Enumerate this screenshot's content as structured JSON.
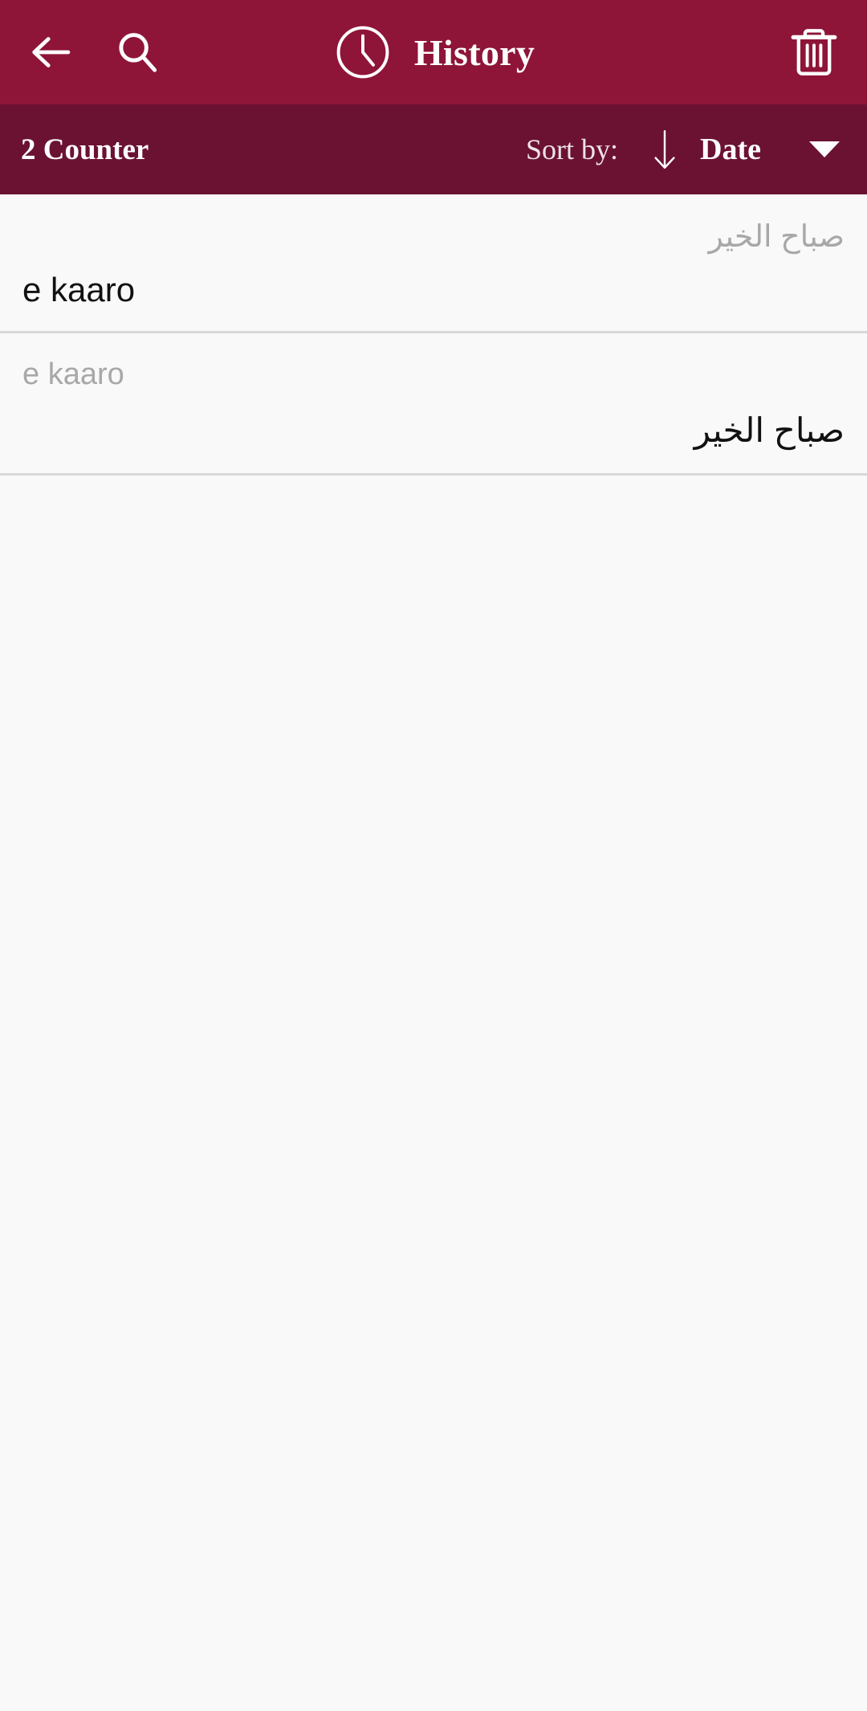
{
  "appbar": {
    "back_icon": "arrow-left-icon",
    "search_icon": "search-icon",
    "clock_icon": "clock-icon",
    "title": "History",
    "delete_icon": "trash-icon"
  },
  "sortbar": {
    "counter_label": "2 Counter",
    "sort_by_label": "Sort by:",
    "sort_direction_icon": "arrow-down-icon",
    "sort_value": "Date",
    "dropdown_icon": "caret-down-icon"
  },
  "history": {
    "entries": [
      {
        "source_text": "صباح الخير",
        "target_text": "e kaaro",
        "source_dir": "rtl",
        "target_dir": "ltr"
      },
      {
        "source_text": "e kaaro",
        "target_text": "صباح الخير",
        "source_dir": "ltr",
        "target_dir": "rtl"
      }
    ]
  },
  "colors": {
    "appbar_bg": "#8E1538",
    "sortbar_bg": "#6B1233",
    "page_bg": "#f9f9f9",
    "primary_text": "#111111",
    "secondary_text": "#a8a8a8",
    "divider": "#d8d8d8",
    "on_primary": "#ffffff"
  }
}
